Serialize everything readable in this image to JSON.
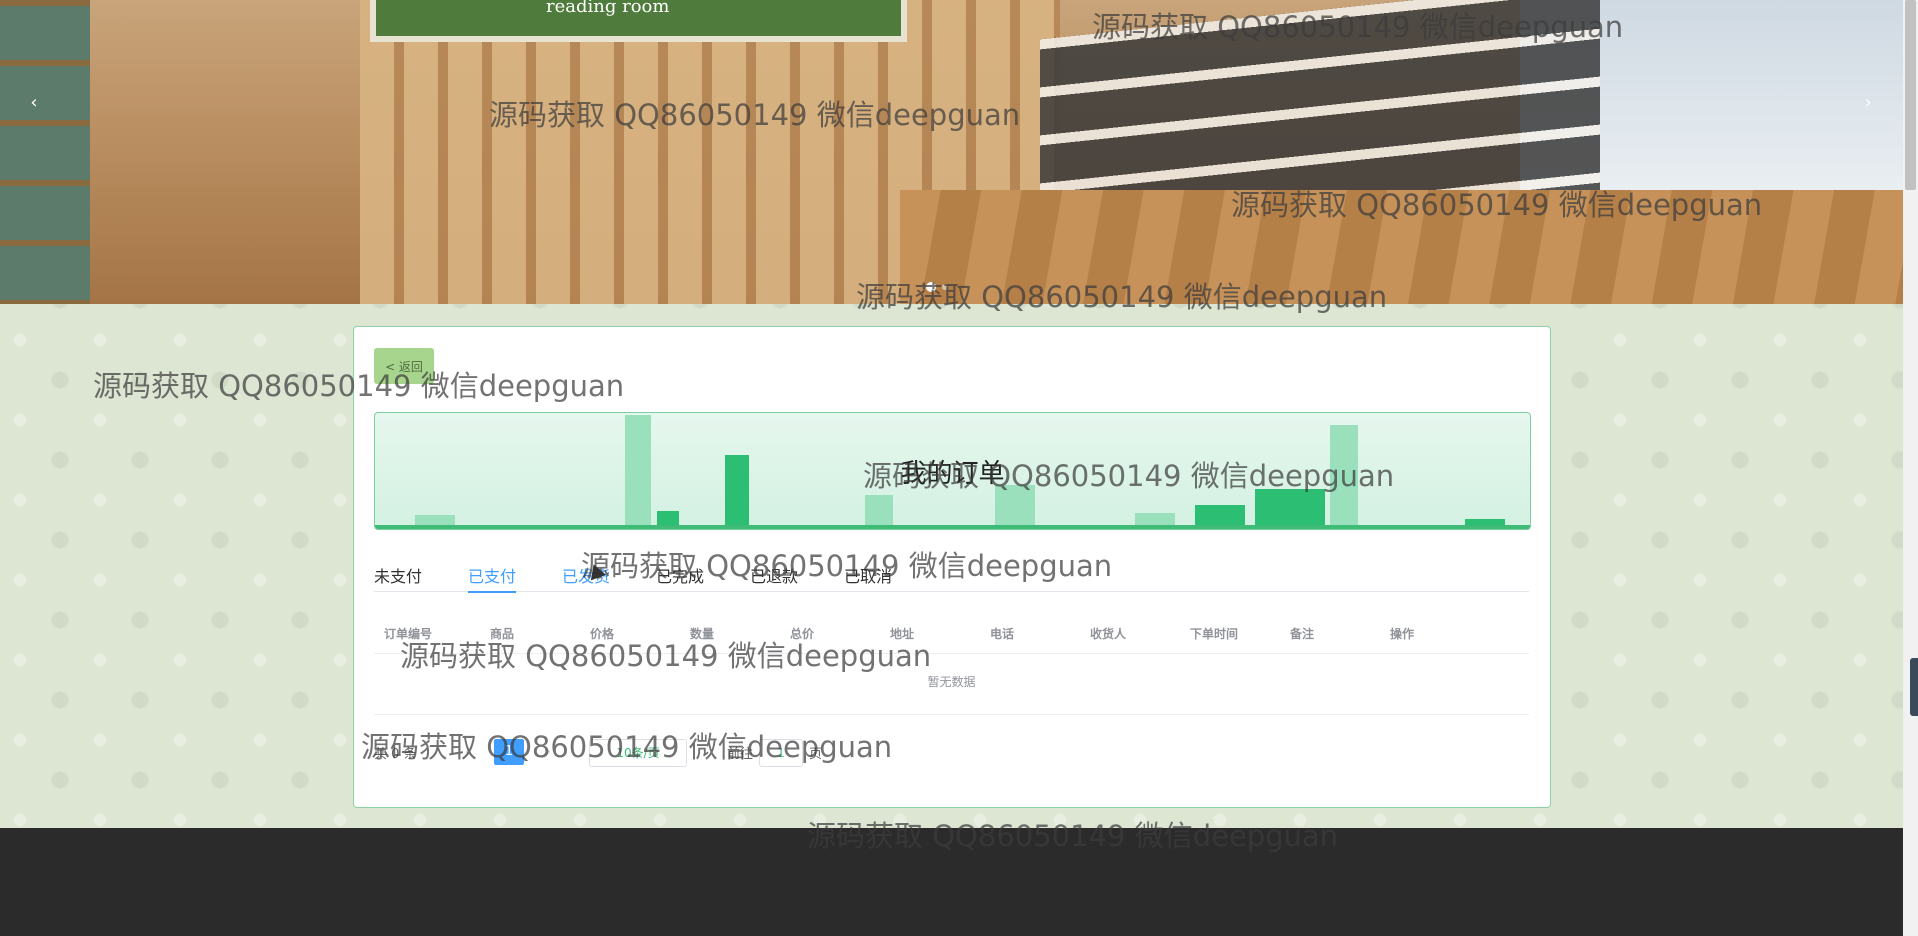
{
  "banner": {
    "prev_arrow": "‹",
    "next_arrow": "›",
    "board_text": "reading room"
  },
  "back_button": {
    "label": "< 返回"
  },
  "page_title": "我的订单",
  "tabs": [
    {
      "label": "未支付"
    },
    {
      "label": "已支付"
    },
    {
      "label": "已发货"
    },
    {
      "label": "已完成"
    },
    {
      "label": "已退款"
    },
    {
      "label": "已取消"
    }
  ],
  "table": {
    "columns": [
      "订单编号",
      "商品",
      "价格",
      "数量",
      "总价",
      "地址",
      "电话",
      "收货人",
      "下单时间",
      "备注",
      "操作"
    ],
    "empty_text": "暂无数据"
  },
  "pagination": {
    "total_text": "共 0 条",
    "current_page": "1",
    "page_size": "10条/页",
    "goto_label": "前往",
    "goto_value": "1",
    "page_unit": "页"
  },
  "watermark": "源码获取 QQ86050149 微信deepguan",
  "colors": {
    "accent": "#409eff",
    "brand_green": "#3fbb78",
    "back_button_bg": "#a7d58e",
    "footer": "#2b2b2b"
  }
}
